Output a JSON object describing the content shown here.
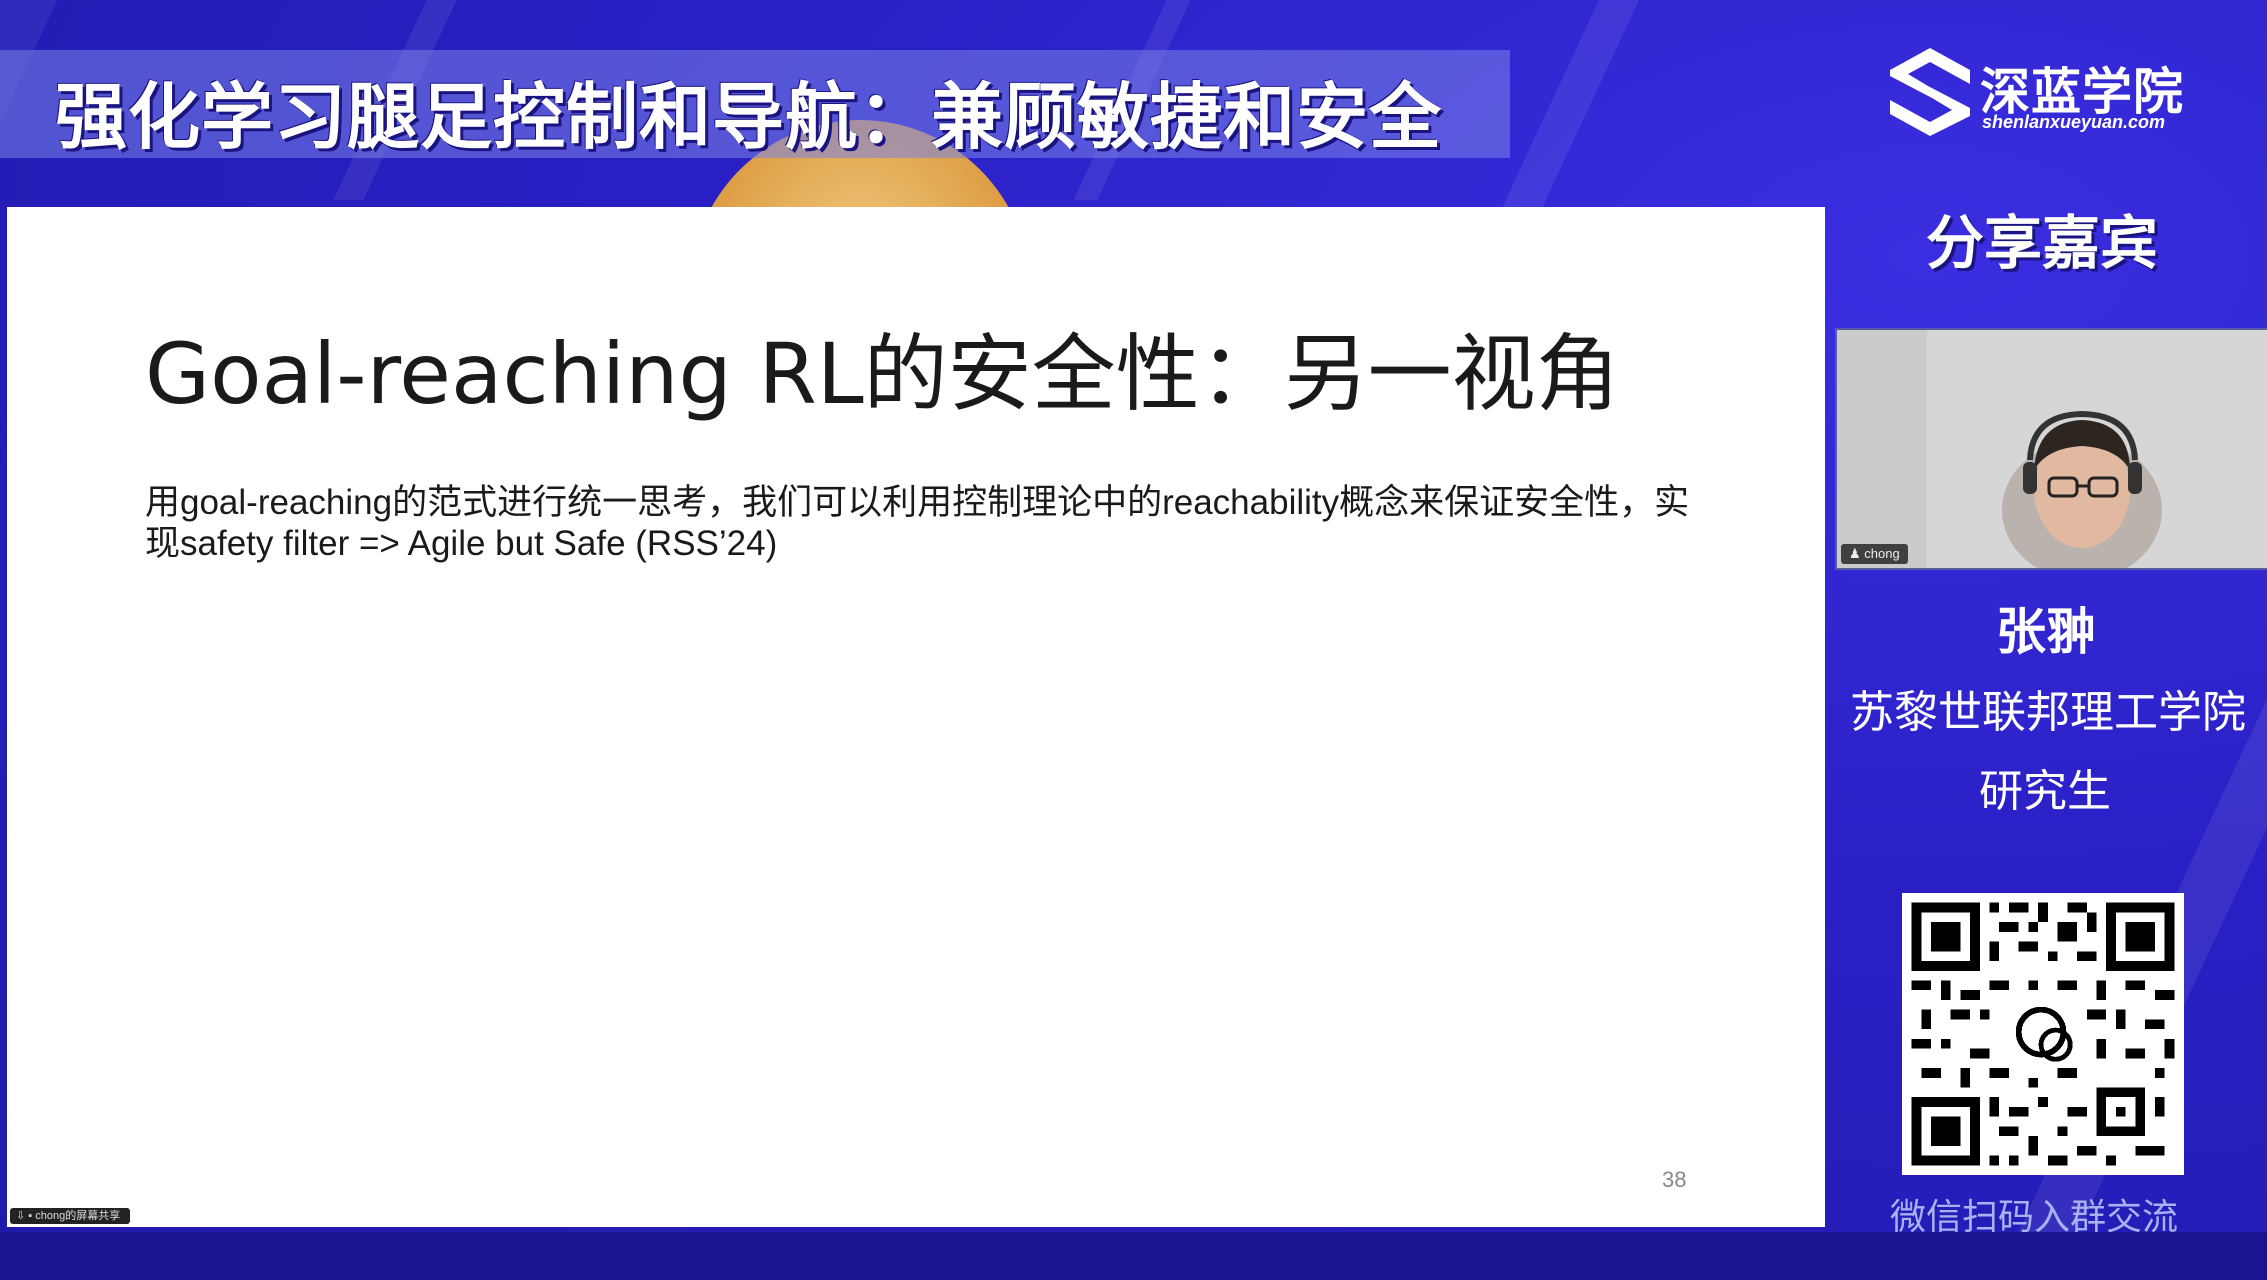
{
  "header": {
    "title": "强化学习腿足控制和导航：兼顾敏捷和安全"
  },
  "logo": {
    "icon": "shenlan-s-logo-icon",
    "name_cn": "深蓝学院",
    "name_en": "shenlanxueyuan.com"
  },
  "slide": {
    "title": "Goal-reaching RL的安全性：另一视角",
    "body": "用goal-reaching的范式进行统一思考，我们可以利用控制理论中的reachability概念来保证安全性，实现safety filter => Agile but Safe (RSS’24)",
    "page_number": "38"
  },
  "screen_share": {
    "label": "chong的屏幕共享"
  },
  "guest": {
    "heading": "分享嘉宾",
    "webcam_label": "chong",
    "name": "张翀",
    "institution": "苏黎世联邦理工学院",
    "role": "研究生"
  },
  "qr": {
    "icon": "wechat-qr-code-icon",
    "caption": "微信扫码入群交流"
  },
  "colors": {
    "background": "#2a22c8",
    "accent": "#e8a640",
    "slide_bg": "#ffffff"
  }
}
